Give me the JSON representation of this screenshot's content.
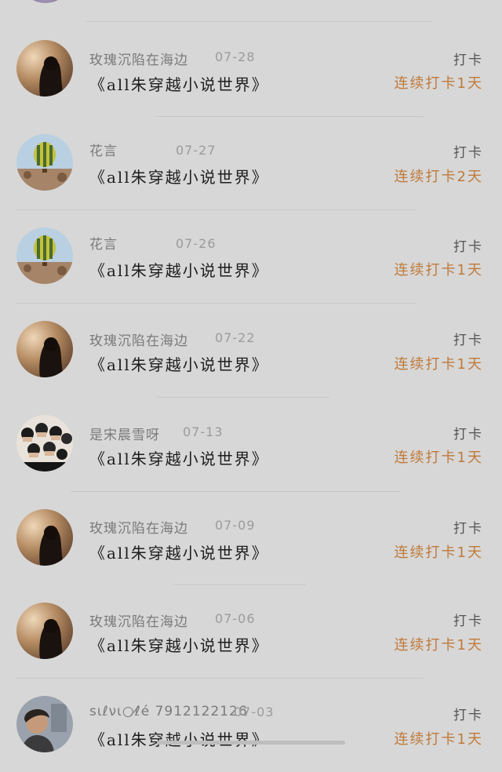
{
  "rows": [
    {
      "name": "玫瑰沉陷在海边",
      "date": "07-28",
      "title": "《all朱穿越小说世界》",
      "tag": "打卡",
      "streak": "连续打卡1天"
    },
    {
      "name": "花言",
      "date": "07-27",
      "title": "《all朱穿越小说世界》",
      "tag": "打卡",
      "streak": "连续打卡2天"
    },
    {
      "name": "花言",
      "date": "07-26",
      "title": "《all朱穿越小说世界》",
      "tag": "打卡",
      "streak": "连续打卡1天"
    },
    {
      "name": "玫瑰沉陷在海边",
      "date": "07-22",
      "title": "《all朱穿越小说世界》",
      "tag": "打卡",
      "streak": "连续打卡1天"
    },
    {
      "name": "是宋晨雪呀",
      "date": "07-13",
      "title": "《all朱穿越小说世界》",
      "tag": "打卡",
      "streak": "连续打卡1天"
    },
    {
      "name": "玫瑰沉陷在海边",
      "date": "07-09",
      "title": "《all朱穿越小说世界》",
      "tag": "打卡",
      "streak": "连续打卡1天"
    },
    {
      "name": "玫瑰沉陷在海边",
      "date": "07-06",
      "title": "《all朱穿越小说世界》",
      "tag": "打卡",
      "streak": "连续打卡1天"
    },
    {
      "name": "sιℓνι○ℓ̸é 7912122126",
      "date": "07-03",
      "title": "《all朱穿越小说世界》",
      "tag": "打卡",
      "streak": "连续打卡1天"
    }
  ],
  "avatar_types": [
    "sunset-girl",
    "balloon",
    "balloon",
    "sunset-girl",
    "group-photo",
    "sunset-girl",
    "sunset-girl",
    "boy-portrait"
  ],
  "colors": {
    "background": "#d7d7d7",
    "streak": "#c07a3a",
    "title": "#1e1e1e"
  }
}
